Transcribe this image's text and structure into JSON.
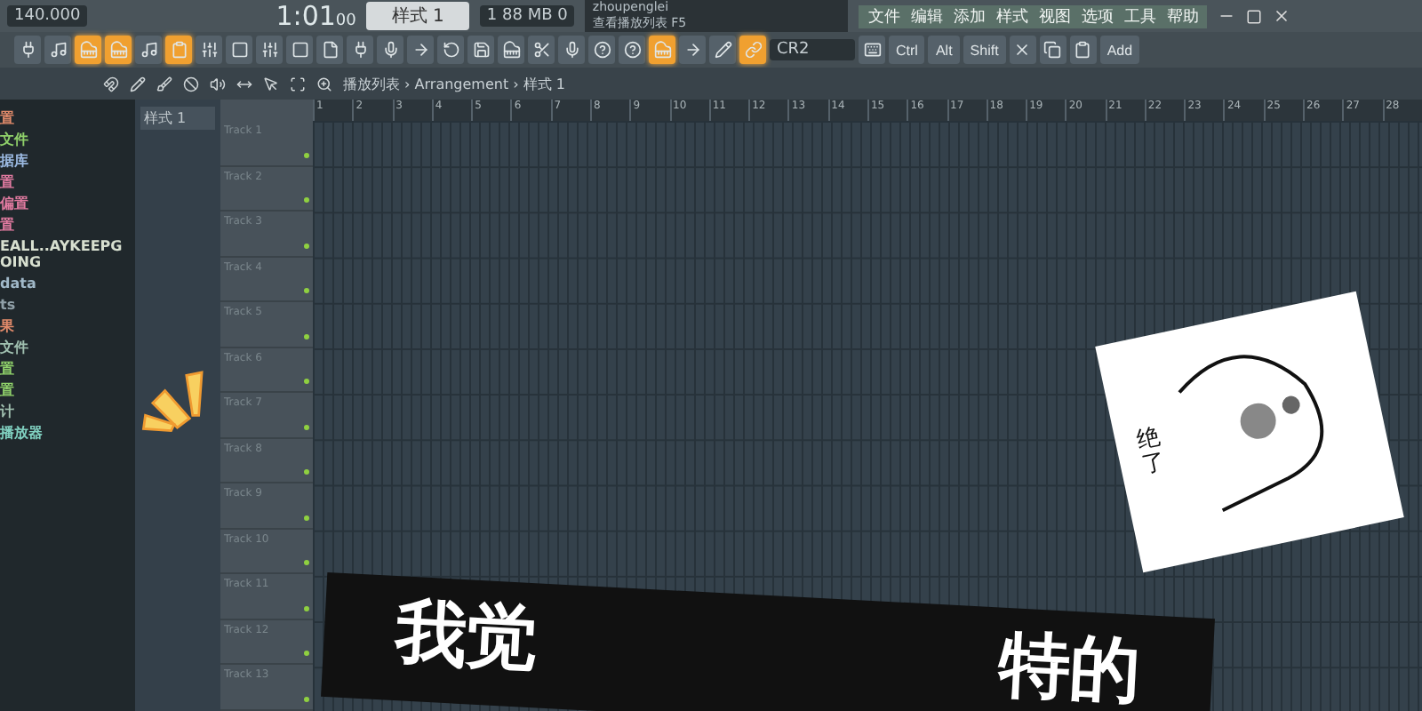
{
  "transport": {
    "tempo": "140.000",
    "time": "1:01",
    "time_sub": "00",
    "pattern": "样式 1",
    "memory": "88 MB",
    "cpu": "1",
    "voices": "0"
  },
  "hint": {
    "line1": "zhoupenglei",
    "line2": "查看播放列表",
    "key": "F5"
  },
  "menu": [
    "文件",
    "编辑",
    "添加",
    "样式",
    "视图",
    "选项",
    "工具",
    "帮助"
  ],
  "toolbar": [
    {
      "selected": false
    },
    {
      "selected": false
    },
    {
      "selected": true
    },
    {
      "selected": true
    },
    {
      "selected": false
    },
    {
      "selected": true
    },
    {
      "selected": false
    },
    {
      "selected": false
    },
    {
      "selected": false
    },
    {
      "selected": false
    },
    {
      "selected": false
    },
    {
      "selected": false
    },
    {
      "selected": false
    },
    {
      "selected": false
    },
    {
      "selected": false
    },
    {
      "selected": false
    },
    {
      "selected": false
    },
    {
      "selected": false
    },
    {
      "selected": false
    },
    {
      "selected": false
    },
    {
      "selected": false
    },
    {
      "selected": true
    },
    {
      "selected": false
    },
    {
      "selected": false
    },
    {
      "selected": true
    }
  ],
  "snap": "CR2",
  "keys": [
    "Ctrl",
    "Alt",
    "Shift"
  ],
  "add": "Add",
  "breadcrumb": "播放列表 › Arrangement › 样式 1",
  "browser": [
    {
      "label": "置",
      "color": "#e08a6a"
    },
    {
      "label": "文件",
      "color": "#8fd06a"
    },
    {
      "label": "据库",
      "color": "#9ab8e0"
    },
    {
      "label": "置",
      "color": "#e07aa0"
    },
    {
      "label": "偏置",
      "color": "#e07aa0"
    },
    {
      "label": "置",
      "color": "#e07aa0"
    },
    {
      "label": "EALL..AYKEEPGOING",
      "color": "#d8e0d0"
    },
    {
      "label": "data",
      "color": "#a0b8c8"
    },
    {
      "label": "ts",
      "color": "#90a0a8"
    },
    {
      "label": "果",
      "color": "#e08a6a"
    },
    {
      "label": "文件",
      "color": "#a0c0b0"
    },
    {
      "label": "置",
      "color": "#8fd06a"
    },
    {
      "label": "置",
      "color": "#8fd06a"
    },
    {
      "label": "计",
      "color": "#a0c0b0"
    },
    {
      "label": "播放器",
      "color": "#80d0c0"
    }
  ],
  "patterns": [
    {
      "label": "样式 1",
      "selected": true
    }
  ],
  "ruler": [
    "1",
    "2",
    "3",
    "4",
    "5",
    "6",
    "7",
    "8",
    "9",
    "10",
    "11",
    "12",
    "13",
    "14",
    "15",
    "16",
    "17",
    "18",
    "19",
    "20",
    "21",
    "22",
    "23",
    "24",
    "25",
    "26",
    "27",
    "28"
  ],
  "tracks": [
    "Track 1",
    "Track 2",
    "Track 3",
    "Track 4",
    "Track 5",
    "Track 6",
    "Track 7",
    "Track 8",
    "Track 9",
    "Track 10",
    "Track 11",
    "Track 12",
    "Track 13"
  ],
  "sticker": {
    "caption": "绝了"
  },
  "banner": [
    "我觉",
    "特的"
  ]
}
